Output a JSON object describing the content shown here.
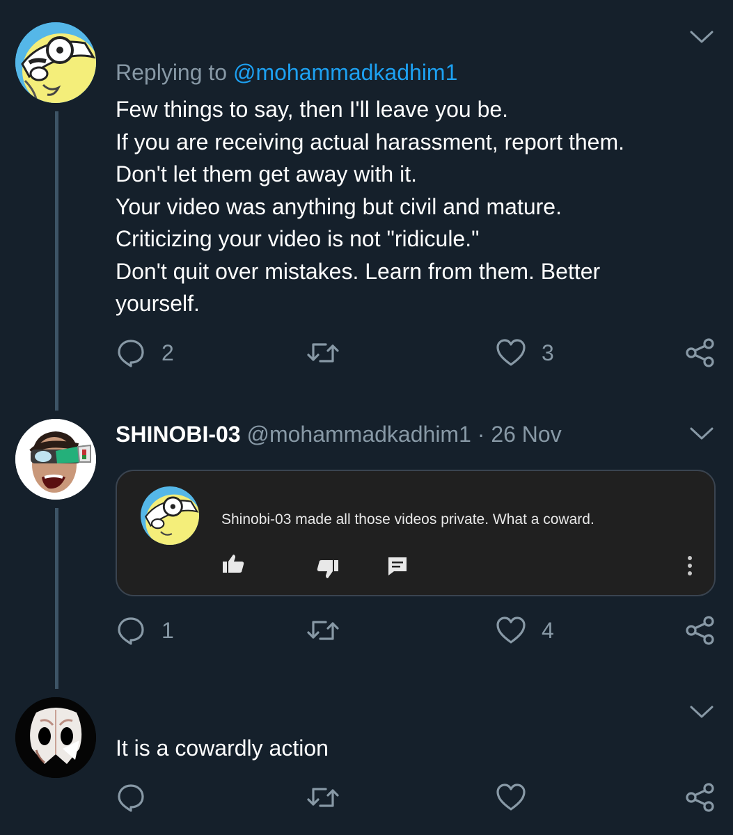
{
  "tweet1": {
    "replying_label": "Replying to",
    "replying_handle": "@mohammadkadhim1",
    "lines": [
      "Few things to say, then I'll leave you be.",
      "If you are receiving actual harassment, report them.",
      "Don't let them get away with it.",
      "Your video was anything but civil and mature.",
      "Criticizing your video is not \"ridicule.\"",
      "Don't quit over mistakes. Learn from them. Better",
      "yourself."
    ],
    "reply_count": "2",
    "like_count": "3"
  },
  "tweet2": {
    "display_name": "SHINOBI-03",
    "handle": "@mohammadkadhim1",
    "separator": "·",
    "date": "26 Nov",
    "embed": {
      "comment": "Shinobi-03 made all those videos private. What a coward."
    },
    "reply_count": "1",
    "like_count": "4"
  },
  "tweet3": {
    "text": "It is a cowardly action"
  },
  "icons": {
    "reply": "reply-icon",
    "retweet": "retweet-icon",
    "like": "heart-icon",
    "share": "share-icon",
    "menu": "chevron-down-icon"
  },
  "colors": {
    "background": "#15202b",
    "link": "#1da1f2",
    "muted": "#8899a6",
    "thread_line": "#3d5466",
    "embed_bg": "#202020"
  }
}
